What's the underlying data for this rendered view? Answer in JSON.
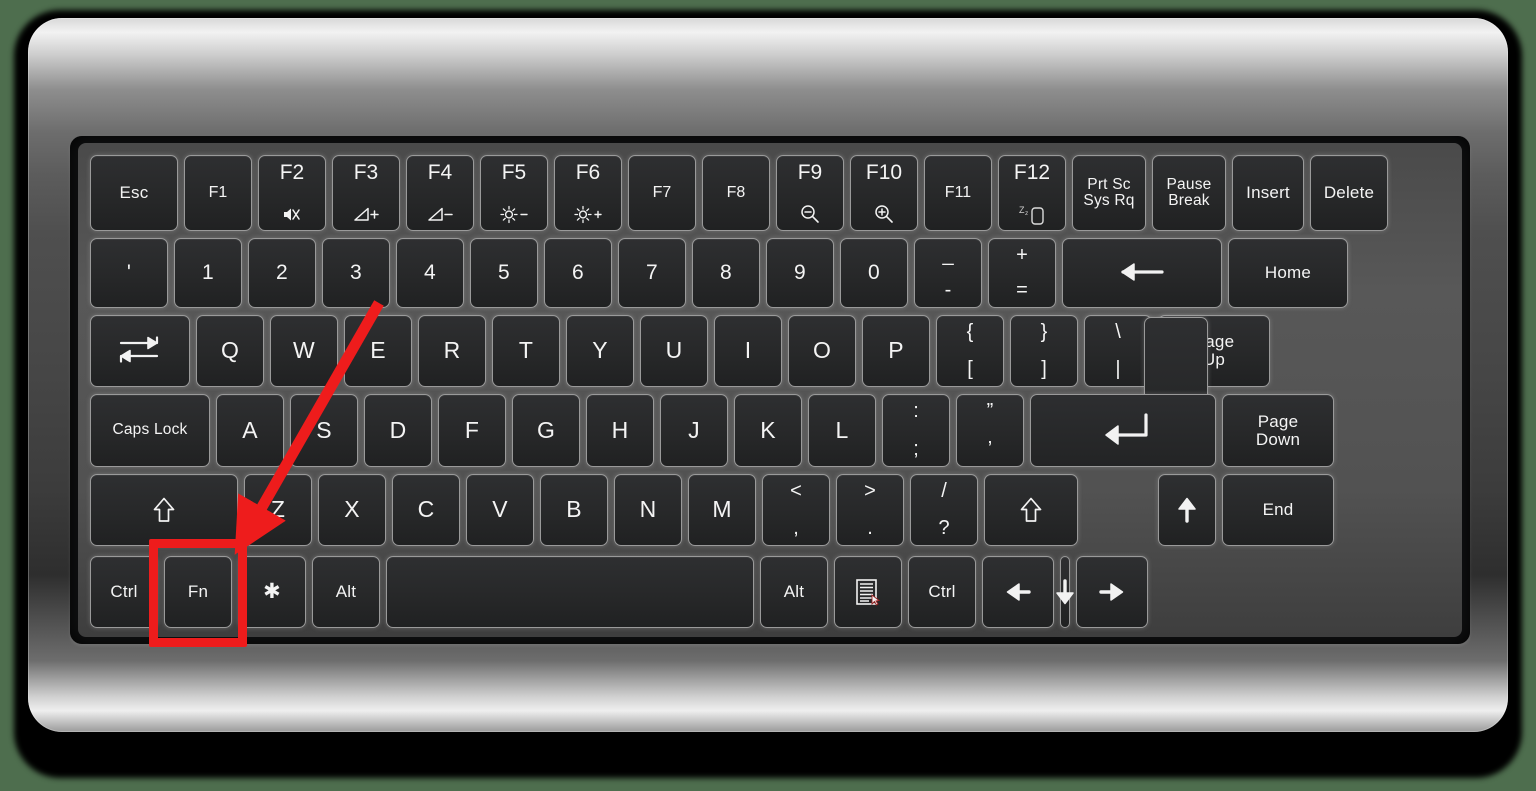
{
  "diagram": {
    "title": "Keyboard layout with Fn key highlighted",
    "background_color": "#4e6e4e",
    "bezel_color": "#5c5c5c",
    "key_color": "#2b2c2e",
    "annotation_color": "#ee1c1c"
  },
  "annotation": {
    "highlight_target": "Fn",
    "highlight_label": "Fn key highlighted in red",
    "arrow_label": "red arrow pointing to Fn key"
  },
  "rows": [
    {
      "name": "function-row",
      "keys": [
        {
          "name": "escape",
          "label": "Esc",
          "style": "small"
        },
        {
          "name": "f1",
          "label": "F1",
          "icon": ""
        },
        {
          "name": "f2",
          "label": "F2",
          "icon": "mute-icon"
        },
        {
          "name": "f3",
          "label": "F3",
          "icon": "volume-up-icon"
        },
        {
          "name": "f4",
          "label": "F4",
          "icon": "volume-down-icon"
        },
        {
          "name": "f5",
          "label": "F5",
          "icon": "brightness-down-icon"
        },
        {
          "name": "f6",
          "label": "F6",
          "icon": "brightness-up-icon"
        },
        {
          "name": "f7",
          "label": "F7",
          "icon": ""
        },
        {
          "name": "f8",
          "label": "F8",
          "icon": ""
        },
        {
          "name": "f9",
          "label": "F9",
          "icon": "zoom-out-icon"
        },
        {
          "name": "f10",
          "label": "F10",
          "icon": "zoom-in-icon"
        },
        {
          "name": "f11",
          "label": "F11",
          "icon": ""
        },
        {
          "name": "f12",
          "label": "F12",
          "icon": "sleep-icon"
        },
        {
          "name": "print-screen",
          "label": "Prt Sc\nSys Rq",
          "style": "tiny"
        },
        {
          "name": "pause-break",
          "label": "Pause\nBreak",
          "style": "tiny"
        },
        {
          "name": "insert",
          "label": "Insert",
          "style": "small"
        },
        {
          "name": "delete",
          "label": "Delete",
          "style": "small"
        }
      ]
    },
    {
      "name": "number-row",
      "keys": [
        {
          "name": "backtick",
          "label": "'"
        },
        {
          "name": "digit-1",
          "label": "1"
        },
        {
          "name": "digit-2",
          "label": "2"
        },
        {
          "name": "digit-3",
          "label": "3"
        },
        {
          "name": "digit-4",
          "label": "4"
        },
        {
          "name": "digit-5",
          "label": "5"
        },
        {
          "name": "digit-6",
          "label": "6"
        },
        {
          "name": "digit-7",
          "label": "7"
        },
        {
          "name": "digit-8",
          "label": "8"
        },
        {
          "name": "digit-9",
          "label": "9"
        },
        {
          "name": "digit-0",
          "label": "0"
        },
        {
          "name": "minus-underscore",
          "top": "_",
          "bot": "-"
        },
        {
          "name": "equals-plus",
          "top": "+",
          "bot": "="
        },
        {
          "name": "backspace",
          "icon": "backspace-arrow-icon"
        },
        {
          "name": "home",
          "label": "Home",
          "style": "small"
        }
      ]
    },
    {
      "name": "qwerty-row",
      "keys": [
        {
          "name": "tab",
          "icon": "tab-arrows-icon"
        },
        {
          "name": "key-q",
          "label": "Q"
        },
        {
          "name": "key-w",
          "label": "W"
        },
        {
          "name": "key-e",
          "label": "E"
        },
        {
          "name": "key-r",
          "label": "R"
        },
        {
          "name": "key-t",
          "label": "T"
        },
        {
          "name": "key-y",
          "label": "Y"
        },
        {
          "name": "key-u",
          "label": "U"
        },
        {
          "name": "key-i",
          "label": "I"
        },
        {
          "name": "key-o",
          "label": "O"
        },
        {
          "name": "key-p",
          "label": "P"
        },
        {
          "name": "bracket-left",
          "top": "{",
          "bot": "["
        },
        {
          "name": "bracket-right",
          "top": "}",
          "bot": "]"
        },
        {
          "name": "backslash-pipe",
          "top": "\\",
          "bot": "|"
        },
        {
          "name": "page-up",
          "label": "Page\nUp",
          "style": "small"
        }
      ]
    },
    {
      "name": "home-row",
      "keys": [
        {
          "name": "caps-lock",
          "label": "Caps Lock",
          "style": "tiny"
        },
        {
          "name": "key-a",
          "label": "A"
        },
        {
          "name": "key-s",
          "label": "S"
        },
        {
          "name": "key-d",
          "label": "D"
        },
        {
          "name": "key-f",
          "label": "F"
        },
        {
          "name": "key-g",
          "label": "G"
        },
        {
          "name": "key-h",
          "label": "H"
        },
        {
          "name": "key-j",
          "label": "J"
        },
        {
          "name": "key-k",
          "label": "K"
        },
        {
          "name": "key-l",
          "label": "L"
        },
        {
          "name": "semicolon-colon",
          "top": ":",
          "bot": ";"
        },
        {
          "name": "quote-apostrophe",
          "top": "”",
          "bot": "’"
        },
        {
          "name": "enter",
          "icon": "enter-arrow-icon"
        },
        {
          "name": "page-down",
          "label": "Page\nDown",
          "style": "small"
        }
      ]
    },
    {
      "name": "shift-row",
      "keys": [
        {
          "name": "shift-left",
          "icon": "shift-outline-icon"
        },
        {
          "name": "key-z",
          "label": "Z"
        },
        {
          "name": "key-x",
          "label": "X"
        },
        {
          "name": "key-c",
          "label": "C"
        },
        {
          "name": "key-v",
          "label": "V"
        },
        {
          "name": "key-b",
          "label": "B"
        },
        {
          "name": "key-n",
          "label": "N"
        },
        {
          "name": "key-m",
          "label": "M"
        },
        {
          "name": "comma-less",
          "top": "<",
          "bot": ","
        },
        {
          "name": "period-greater",
          "top": ">",
          "bot": "."
        },
        {
          "name": "slash-question",
          "top": "/",
          "bot": "?"
        },
        {
          "name": "shift-right",
          "icon": "shift-outline-icon"
        },
        {
          "name": "spacer-blank",
          "label": ""
        },
        {
          "name": "arrow-up",
          "icon": "arrow-up-icon"
        },
        {
          "name": "end",
          "label": "End",
          "style": "small"
        }
      ]
    },
    {
      "name": "bottom-row",
      "keys": [
        {
          "name": "ctrl-left",
          "label": "Ctrl",
          "style": "small"
        },
        {
          "name": "fn",
          "label": "Fn",
          "style": "small"
        },
        {
          "name": "star",
          "label": "✱"
        },
        {
          "name": "alt-left",
          "label": "Alt",
          "style": "small"
        },
        {
          "name": "spacebar",
          "label": ""
        },
        {
          "name": "alt-right",
          "label": "Alt",
          "style": "small"
        },
        {
          "name": "menu",
          "icon": "context-menu-icon"
        },
        {
          "name": "ctrl-right",
          "label": "Ctrl",
          "style": "small"
        },
        {
          "name": "arrow-left",
          "icon": "arrow-left-icon"
        },
        {
          "name": "arrow-down",
          "icon": "arrow-down-icon"
        },
        {
          "name": "arrow-right",
          "icon": "arrow-right-icon"
        }
      ]
    }
  ]
}
